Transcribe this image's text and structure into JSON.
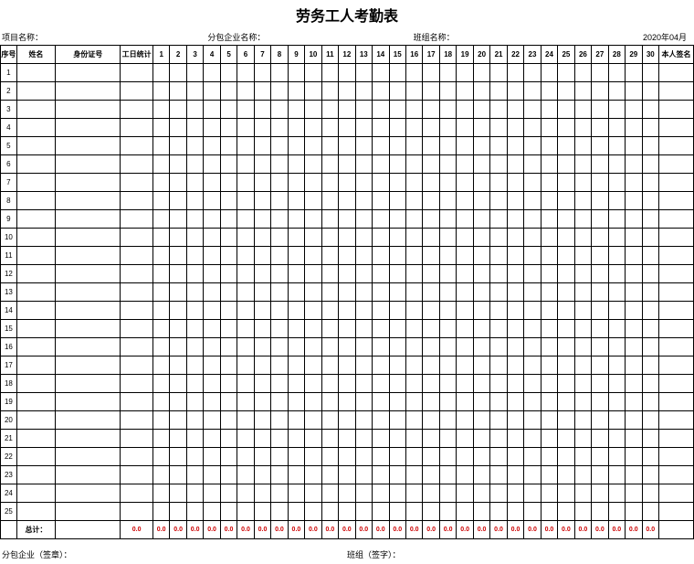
{
  "title": "劳务工人考勤表",
  "meta": {
    "project_label": "项目名称：",
    "subcontract_label": "分包企业名称：",
    "team_label": "班组名称：",
    "date": "2020年04月"
  },
  "headers": {
    "seq": "序号",
    "name": "姓名",
    "id": "身份证号",
    "stat": "工日统计",
    "days": [
      "1",
      "2",
      "3",
      "4",
      "5",
      "6",
      "7",
      "8",
      "9",
      "10",
      "11",
      "12",
      "13",
      "14",
      "15",
      "16",
      "17",
      "18",
      "19",
      "20",
      "21",
      "22",
      "23",
      "24",
      "25",
      "26",
      "27",
      "28",
      "29",
      "30"
    ],
    "sign": "本人签名"
  },
  "rows": [
    "1",
    "2",
    "3",
    "4",
    "5",
    "6",
    "7",
    "8",
    "9",
    "10",
    "11",
    "12",
    "13",
    "14",
    "15",
    "16",
    "17",
    "18",
    "19",
    "20",
    "21",
    "22",
    "23",
    "24",
    "25"
  ],
  "total": {
    "label": "总计：",
    "stat": "0.0",
    "days": [
      "0.0",
      "0.0",
      "0.0",
      "0.0",
      "0.0",
      "0.0",
      "0.0",
      "0.0",
      "0.0",
      "0.0",
      "0.0",
      "0.0",
      "0.0",
      "0.0",
      "0.0",
      "0.0",
      "0.0",
      "0.0",
      "0.0",
      "0.0",
      "0.0",
      "0.0",
      "0.0",
      "0.0",
      "0.0",
      "0.0",
      "0.0",
      "0.0",
      "0.0",
      "0.0"
    ]
  },
  "footer": {
    "left": "分包企业（签章）：",
    "right": "班组（签字）："
  }
}
